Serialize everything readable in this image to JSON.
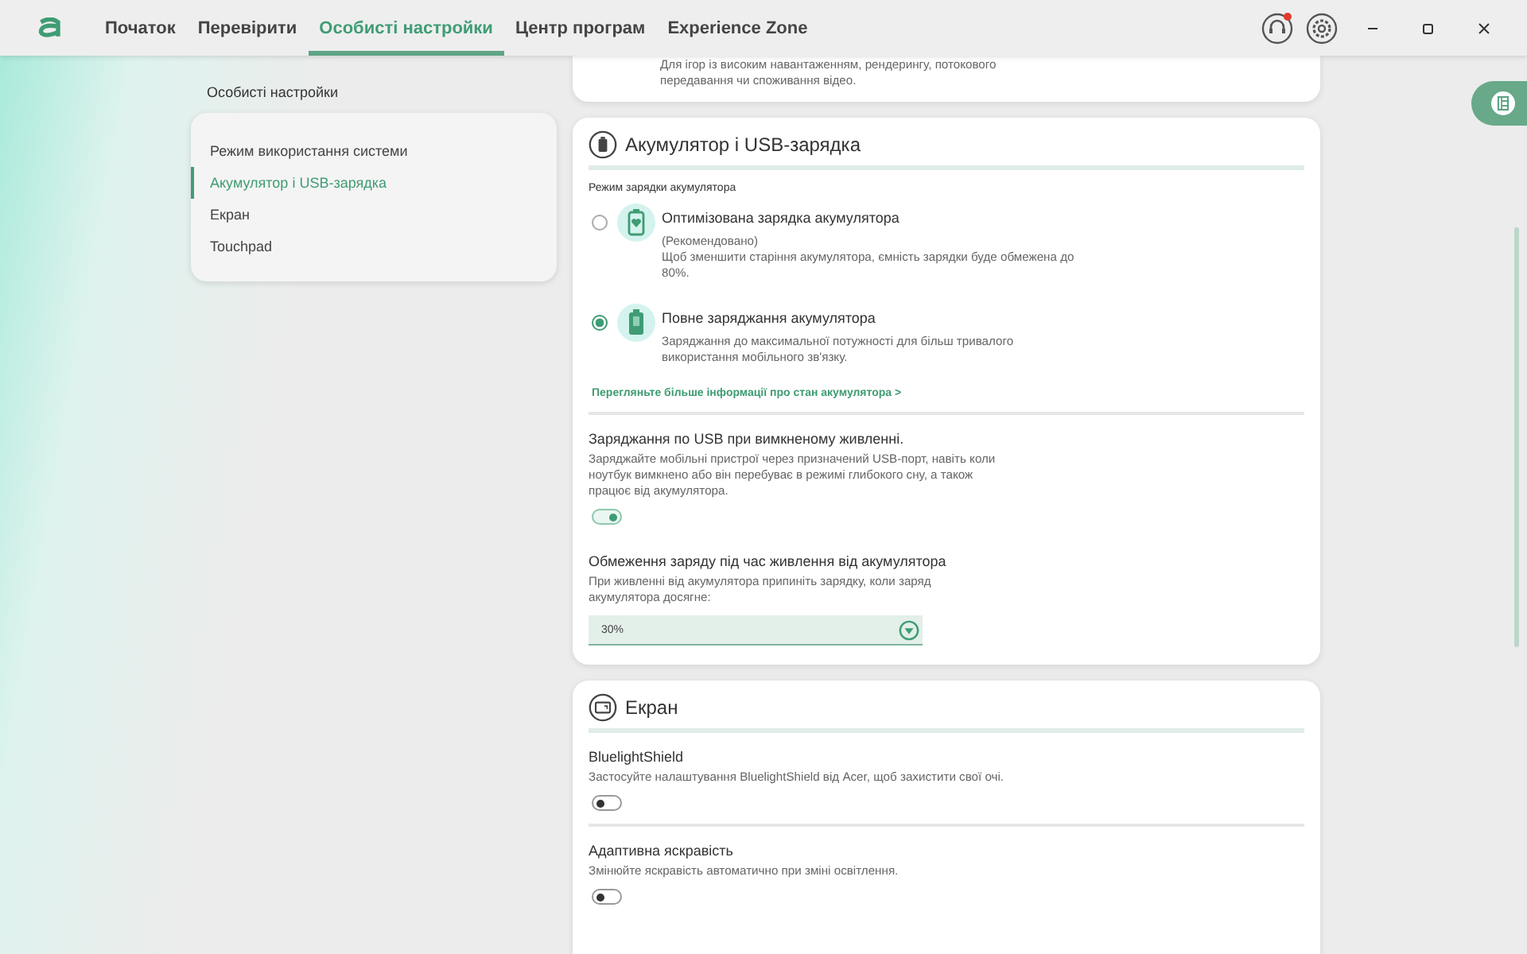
{
  "nav": {
    "tabs": [
      {
        "label": "Початок",
        "selected": false
      },
      {
        "label": "Перевірити",
        "selected": false
      },
      {
        "label": "Особисті настройки",
        "selected": true
      },
      {
        "label": "Центр програм",
        "selected": false
      },
      {
        "label": "Experience Zone",
        "selected": false
      }
    ],
    "support_notification": true
  },
  "sidebar": {
    "title": "Особисті настройки",
    "items": [
      {
        "label": "Режим використання системи",
        "selected": false
      },
      {
        "label": "Акумулятор і USB-зарядка",
        "selected": true
      },
      {
        "label": "Екран",
        "selected": false
      },
      {
        "label": "Touchpad",
        "selected": false
      }
    ]
  },
  "top_card": {
    "description": "Для ігор із високим навантаженням, рендерингу, потокового передавання чи споживання відео."
  },
  "battery_section": {
    "title": "Акумулятор і USB-зарядка",
    "mode_label": "Режим зарядки акумулятора",
    "options": [
      {
        "kind": "heart",
        "title": "Оптимізована зарядка акумулятора",
        "note": "(Рекомендовано)",
        "description": "Щоб зменшити старіння акумулятора, ємність зарядки буде обмежена до 80%.",
        "selected": false
      },
      {
        "kind": "full",
        "title": "Повне заряджання акумулятора",
        "description": "Заряджання до максимальної потужності для більш тривалого використання мобільного зв'язку.",
        "selected": true
      }
    ],
    "link": "Перегляньте більше інформації про стан акумулятора >",
    "usb_charging": {
      "title": "Заряджання по USB при вимкненому живленні.",
      "description": "Заряджайте мобільні пристрої через призначений USB-порт, навіть коли ноутбук вимкнено або він перебуває в режимі глибокого сну, а також працює від акумулятора.",
      "on": true
    },
    "charge_limit": {
      "title": "Обмеження заряду під час живлення від акумулятора",
      "description": "При живленні від акумулятора припиніть зарядку, коли заряд акумулятора досягне:",
      "value": "30%"
    }
  },
  "display_section": {
    "title": "Екран",
    "settings": [
      {
        "title": "BluelightShield",
        "description": "Застосуйте налаштування BluelightShield від Acer, щоб захистити свої очі.",
        "on": false
      },
      {
        "title": "Адаптивна яскравість",
        "description": "Змінюйте яскравість автоматично при зміні освітлення.",
        "on": false
      }
    ]
  }
}
